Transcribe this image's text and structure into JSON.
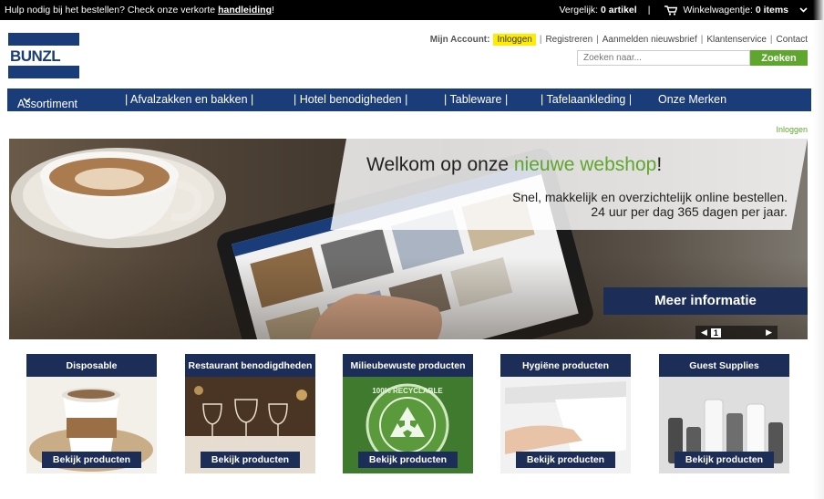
{
  "topbar": {
    "help_text": "Hulp nodig bij het bestellen? Check onze verkorte ",
    "help_link": "handleiding",
    "help_end": "!",
    "compare_label": "Vergelijk:",
    "compare_value": "0 artikel",
    "separator": "|",
    "cart_label": "Winkelwagentje:",
    "cart_value": "0 items"
  },
  "brand": {
    "logo_text": "BUNZL",
    "color": "#1a3d7a"
  },
  "account": {
    "label": "Mijn Account:",
    "login": "Inloggen",
    "register": "Registreren",
    "newsletter": "Aanmelden nieuwsbrief",
    "service": "Klantenservice",
    "contact": "Contact"
  },
  "search": {
    "placeholder": "Zoeken naar...",
    "button": "Zoeken"
  },
  "nav": {
    "assortiment": "Assortiment",
    "items": [
      "| Afvalzakken en bakken |",
      "| Hotel benodigheden |",
      "| Tableware |",
      "| Tafelaankleding |",
      "Onze Merken"
    ]
  },
  "login_link": "Inloggen",
  "hero": {
    "welcome_pre": "Welkom op onze ",
    "welcome_green": "nieuwe webshop",
    "welcome_post": "!",
    "tagline1": "Snel, makkelijk en overzichtelijk online bestellen.",
    "tagline2": "24 uur per dag 365 dagen per jaar.",
    "more_button": "Meer informatie",
    "slide_prev": "◀",
    "slide_number": "1",
    "slide_next": "▶"
  },
  "categories": [
    {
      "title": "Disposable",
      "button": "Bekijk producten"
    },
    {
      "title": "Restaurant benodigdheden",
      "button": "Bekijk producten"
    },
    {
      "title": "Milieubewuste producten",
      "button": "Bekijk producten"
    },
    {
      "title": "Hygiëne producten",
      "button": "Bekijk producten"
    },
    {
      "title": "Guest Supplies",
      "button": "Bekijk producten"
    }
  ],
  "recycle_text": "100% RECYCLABLE",
  "colors": {
    "navy": "#1c2d57",
    "nav_blue": "#1a3d7a",
    "green": "#5ea62d",
    "yellow": "#ffec00"
  }
}
